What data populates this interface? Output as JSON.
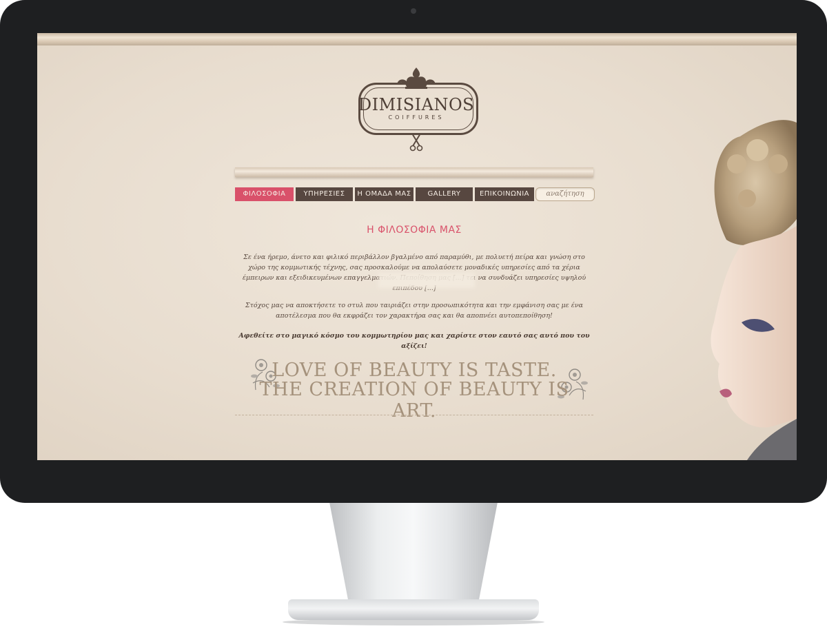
{
  "logo": {
    "name": "DIMISIANOS",
    "subtitle": "COIFFURES"
  },
  "nav": {
    "items": [
      {
        "label": "ΦΙΛΟΣΟΦΙΑ",
        "active": true
      },
      {
        "label": "ΥΠΗΡΕΣΙΕΣ",
        "active": false
      },
      {
        "label": "Η ΟΜΑΔΑ ΜΑΣ",
        "active": false
      },
      {
        "label": "GALLERY",
        "active": false
      },
      {
        "label": "ΕΠΙΚΟΙΝΩΝΙΑ",
        "active": false
      }
    ],
    "search_placeholder": "αναζήτηση"
  },
  "main": {
    "heading": "Η ΦΙΛΟΣΟΦΙΑ ΜΑΣ",
    "paragraph1": "Σε ένα ήρεμο, άνετο και φιλικό περιβάλλον βγαλμένο από παραμύθι, με πολυετή πείρα και γνώση στο χώρο της κομμωτικής τέχνης, σας προσκαλούμε να απολαύσετε μοναδικές υπηρεσίες από τα χέρια έμπειρων και εξειδικευμένων επαγγελματιών. Πεποίθηση μας [...] τει να συνδυάζει υπηρεσίες υψηλού επιπέδου [...]",
    "paragraph2": "Στόχος μας να αποκτήσετε το στυλ που ταιριάζει στην προσωπικότητα και την εμφάνιση σας με ένα αποτέλεσμα που θα εκφράζει τον χαρακτήρα σας και θα αποπνέει αυτοπεποίθηση!",
    "paragraph3": "Αφεθείτε στο μαγικό κόσμο του κομμωτηρίου μας και χαρίστε στον εαυτό σας αυτό που του αξίζει!",
    "quote_line1": "LOVE OF BEAUTY IS TASTE.",
    "quote_line2": "THE CREATION OF BEAUTY IS ART."
  },
  "colors": {
    "accent": "#d9516a",
    "nav_bg": "#574740",
    "text": "#5a4a40",
    "quote": "#a5927c",
    "page_bg": "#ebe1d4",
    "bezel": "#1e1f21"
  }
}
